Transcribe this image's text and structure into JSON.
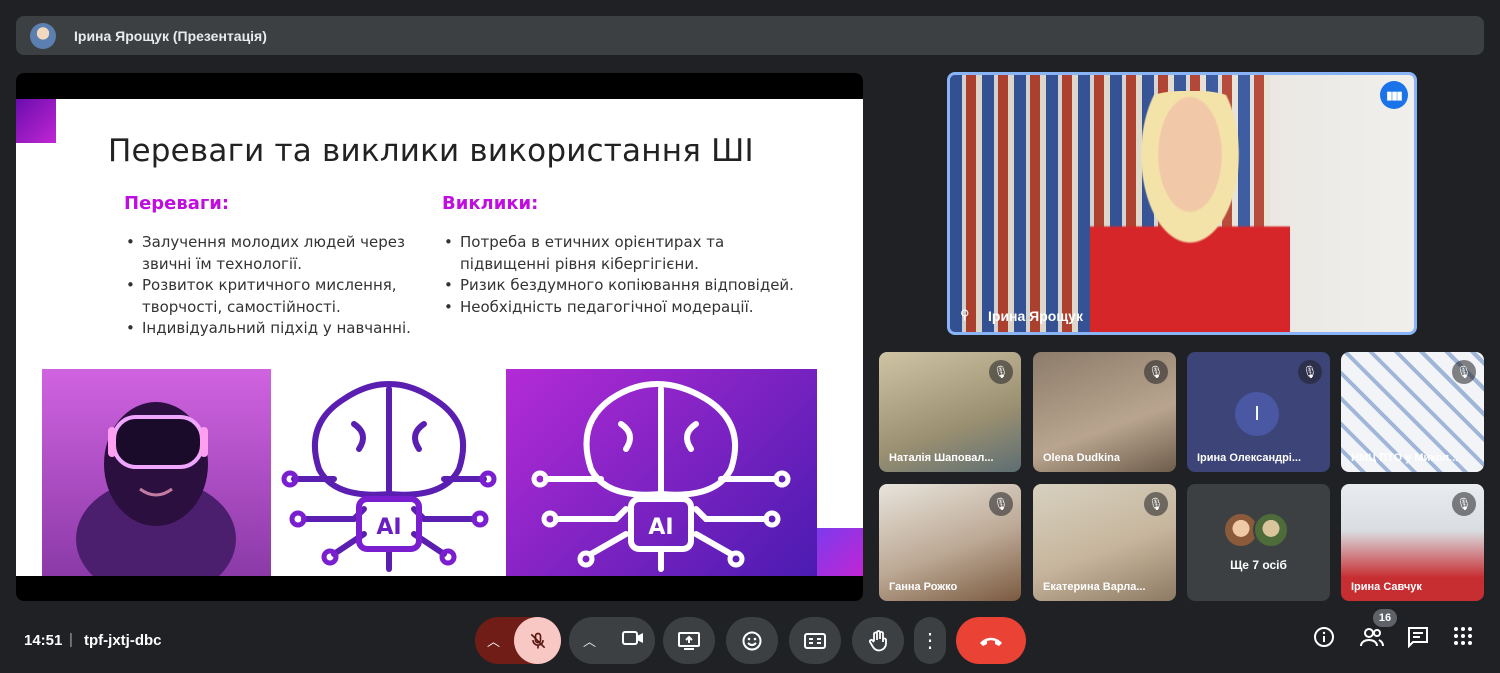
{
  "banner": {
    "title": "Ірина Ярощук (Презентація)"
  },
  "slide": {
    "title": "Переваги та виклики використання ШІ",
    "advantages": {
      "heading": "Переваги:",
      "items": [
        "Залучення молодих людей через звичні їм технології.",
        "Розвиток критичного мислення, творчості, самостійності.",
        "Індивідуальний підхід у навчанні."
      ]
    },
    "challenges": {
      "heading": "Виклики:",
      "items": [
        "Потреба в етичних орієнтирах та підвищенні рівня кібергігієни.",
        "Ризик бездумного копіювання відповідей.",
        "Необхідність педагогічної модерації."
      ]
    },
    "ai_label": "AI"
  },
  "speaker": {
    "name": "Ірина Ярощук"
  },
  "participants": [
    {
      "name": "Наталія Шаповал..."
    },
    {
      "name": "Olena Dudkina"
    },
    {
      "name": "Ірина Олександрі...",
      "initial": "І"
    },
    {
      "name": "НМЦ ПТО у Микол..."
    },
    {
      "name": "Ганна Рожко"
    },
    {
      "name": "Екатерина Варла..."
    },
    {
      "more_label": "Ще 7 осіб"
    },
    {
      "name": "Ірина Савчук"
    }
  ],
  "controls": {
    "time": "14:51",
    "separator": "|",
    "meeting_code": "tpf-jxtj-dbc",
    "participant_count": "16"
  },
  "icons": {
    "mic_off": "mic-off-icon",
    "camera": "camera-icon",
    "present": "present-screen-icon",
    "emoji": "emoji-icon",
    "captions": "captions-icon",
    "hand": "raise-hand-icon",
    "more": "more-vert-icon",
    "leave": "end-call-icon",
    "info": "info-icon",
    "people": "people-icon",
    "chat": "chat-icon",
    "activities": "apps-grid-icon"
  },
  "colors": {
    "accent_purple": "#c10ee0",
    "leave_red": "#ea4335",
    "speaker_border": "#8ab4f8",
    "muted_red_bg": "#f8c9c4"
  }
}
